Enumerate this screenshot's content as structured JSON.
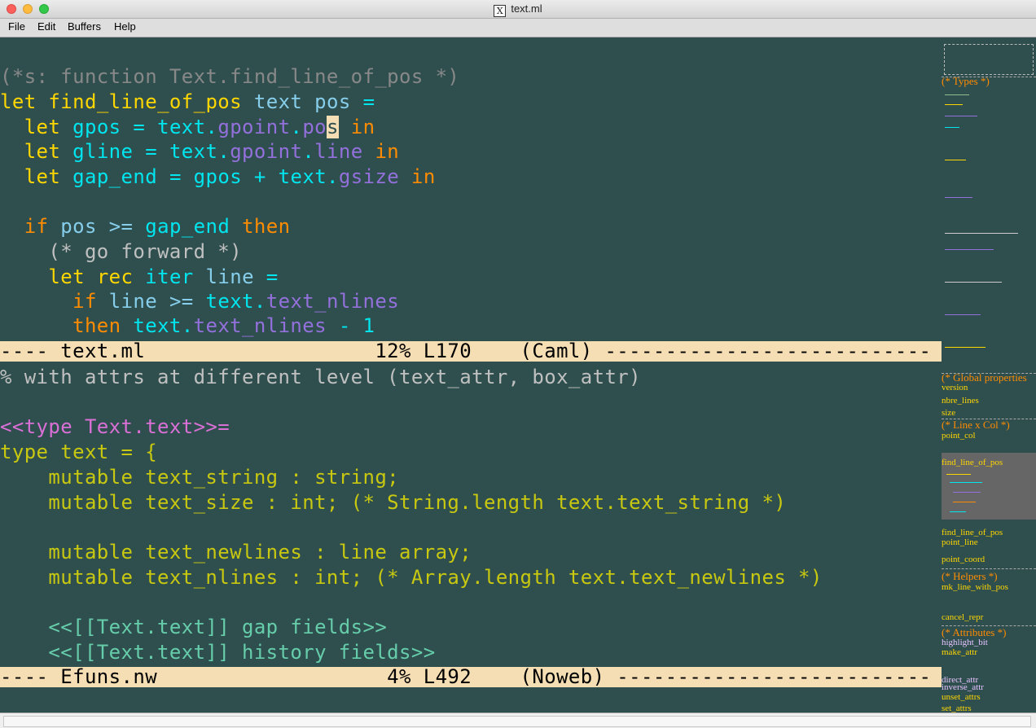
{
  "window": {
    "title": "text.ml"
  },
  "menu": {
    "file": "File",
    "edit": "Edit",
    "buffers": "Buffers",
    "help": "Help"
  },
  "upper_pane": {
    "lines": {
      "l1": "(*s: function Text.find_line_of_pos *)",
      "l2_kw": "let",
      "l2_fn": "find_line_of_pos",
      "l2_p1": "text",
      "l2_p2": "pos",
      "l2_eq": "=",
      "l3_kw": "let",
      "l3_v": "gpos",
      "l3_eq": "=",
      "l3_obj": "text.",
      "l3_f": "gpoint",
      "l3_dot": ".",
      "l3_f2a": "po",
      "l3_cur": "s",
      "l3_in": "in",
      "l4_kw": "let",
      "l4_v": "gline",
      "l4_eq": "=",
      "l4_obj": "text.",
      "l4_f": "gpoint",
      "l4_dot": ".",
      "l4_f2": "line",
      "l4_in": "in",
      "l5_kw": "let",
      "l5_v": "gap_end",
      "l5_eq": "=",
      "l5_a": "gpos",
      "l5_plus": "+",
      "l5_obj": "text.",
      "l5_f": "gsize",
      "l5_in": "in",
      "l7_if": "if",
      "l7_p": "pos",
      "l7_op": ">=",
      "l7_v": "gap_end",
      "l7_then": "then",
      "l8": "(* go forward *)",
      "l9_kw": "let",
      "l9_rec": "rec",
      "l9_fn": "iter",
      "l9_p": "line",
      "l9_eq": "=",
      "l10_if": "if",
      "l10_p": "line",
      "l10_op": ">=",
      "l10_obj": "text.",
      "l10_f": "text_nlines",
      "l11_then": "then",
      "l11_obj": "text.",
      "l11_f": "text_nlines",
      "l11_rest": "- 1"
    },
    "modeline": "---- text.ml                   12% L170    (Caml) ---------------------------"
  },
  "lower_pane": {
    "lines": {
      "l1": "% with attrs at different level (text_attr, box_attr)",
      "l3": "<<type Text.text>>=",
      "l4": "type text = {",
      "l5": "    mutable text_string : string;",
      "l6": "    mutable text_size : int; (* String.length text.text_string *)",
      "l8": "    mutable text_newlines : line array;",
      "l9": "    mutable text_nlines : int; (* Array.length text.text_newlines *)",
      "l11": "    <<[[Text.text]] gap fields>>",
      "l12": "    <<[[Text.text]] history fields>>"
    },
    "modeline": "---- Efuns.nw                   4% L492    (Noweb) --------------------------"
  },
  "minimap": {
    "types": "(* Types *)",
    "global_props": "(* Global properties",
    "version": "version",
    "nbre_lines": "nbre_lines",
    "size": "size",
    "line_x_col": "(* Line x Col *)",
    "point_col": "point_col",
    "find_line_of_pos": "find_line_of_pos",
    "find_line_of_pos2": "find_line_of_pos",
    "point_line": "point_line",
    "point_coord": "point_coord",
    "helpers": "(* Helpers *)",
    "mk_line_with_pos": "mk_line_with_pos",
    "cancel_repr": "cancel_repr",
    "attributes": "(* Attributes *)",
    "highlight_bit": "highlight_bit",
    "make_attr": "make_attr",
    "direct_attr": "direct_attr",
    "inverse_attr": "inverse_attr",
    "unset_attrs": "unset_attrs",
    "set_attrs": "set_attrs"
  },
  "colors": {
    "background": "#2f4f4f",
    "modeline": "#f5deb3",
    "keyword": "#ffd700",
    "keyword2": "#ff8c00",
    "identifier": "#00e5ee",
    "field": "#9370db"
  }
}
